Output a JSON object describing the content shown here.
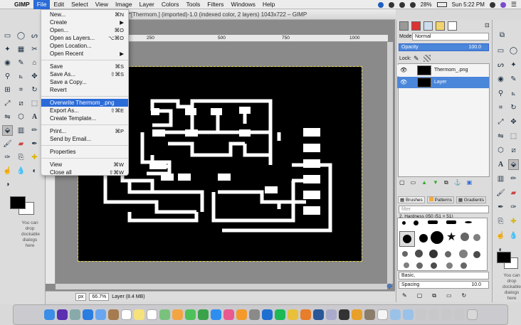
{
  "menubar": {
    "apple": "",
    "app_name": "GIMP",
    "items": [
      "File",
      "Edit",
      "Select",
      "View",
      "Image",
      "Layer",
      "Colors",
      "Tools",
      "Filters",
      "Windows",
      "Help"
    ],
    "battery": "28%",
    "clock": "Sun 5:22 PM"
  },
  "window": {
    "title": "*[Thermom.] (imported)-1.0 (indexed color, 2 layers) 1043x722 – GIMP"
  },
  "file_menu": {
    "items": [
      {
        "label": "New...",
        "shortcut": "⌘N"
      },
      {
        "label": "Create",
        "shortcut": "▶"
      },
      {
        "label": "Open...",
        "shortcut": "⌘O"
      },
      {
        "label": "Open as Layers...",
        "shortcut": "⌥⌘O"
      },
      {
        "label": "Open Location...",
        "shortcut": ""
      },
      {
        "label": "Open Recent",
        "shortcut": "▶"
      },
      {
        "label": "Save",
        "shortcut": "⌘S"
      },
      {
        "label": "Save As...",
        "shortcut": "⇧⌘S"
      },
      {
        "label": "Save a Copy...",
        "shortcut": ""
      },
      {
        "label": "Revert",
        "shortcut": ""
      },
      {
        "label": "Overwrite Thermom_.png",
        "shortcut": ""
      },
      {
        "label": "Export As...",
        "shortcut": "⇧⌘E"
      },
      {
        "label": "Create Template...",
        "shortcut": ""
      },
      {
        "label": "Print...",
        "shortcut": "⌘P"
      },
      {
        "label": "Send by Email...",
        "shortcut": ""
      },
      {
        "label": "Properties",
        "shortcut": ""
      },
      {
        "label": "View",
        "shortcut": "⌘W"
      },
      {
        "label": "Close all",
        "shortcut": "⇧⌘W"
      }
    ]
  },
  "rulers": {
    "ticks": [
      "250",
      "500",
      "750",
      "1000"
    ]
  },
  "statusbar": {
    "unit": "px",
    "zoom": "66.7%",
    "layer_info": "Layer (8.4 MB)"
  },
  "toolbox": {
    "drop_note": "You can drop dockable dialogs here"
  },
  "layers_panel": {
    "mode_label": "Mode:",
    "mode_value": "Normal",
    "opacity_label": "Opacity",
    "opacity_value": "100.0",
    "lock_label": "Lock:",
    "layers": [
      {
        "name": "Thermom_.png",
        "selected": false
      },
      {
        "name": "Layer",
        "selected": true
      }
    ]
  },
  "brushes_panel": {
    "tabs": [
      "Brushes",
      "Patterns",
      "Gradients"
    ],
    "filter_placeholder": "filter",
    "brush_name": "2. Hardness 050 (51 × 51)",
    "preset": "Basic,",
    "spacing_label": "Spacing",
    "spacing_value": "10.0"
  },
  "right_dock": {
    "drop_note": "You can drop dockable dialogs here"
  },
  "colors": {
    "accent": "#2a6bd8",
    "canvas_bg": "#000000",
    "traces": "#ffffff"
  }
}
